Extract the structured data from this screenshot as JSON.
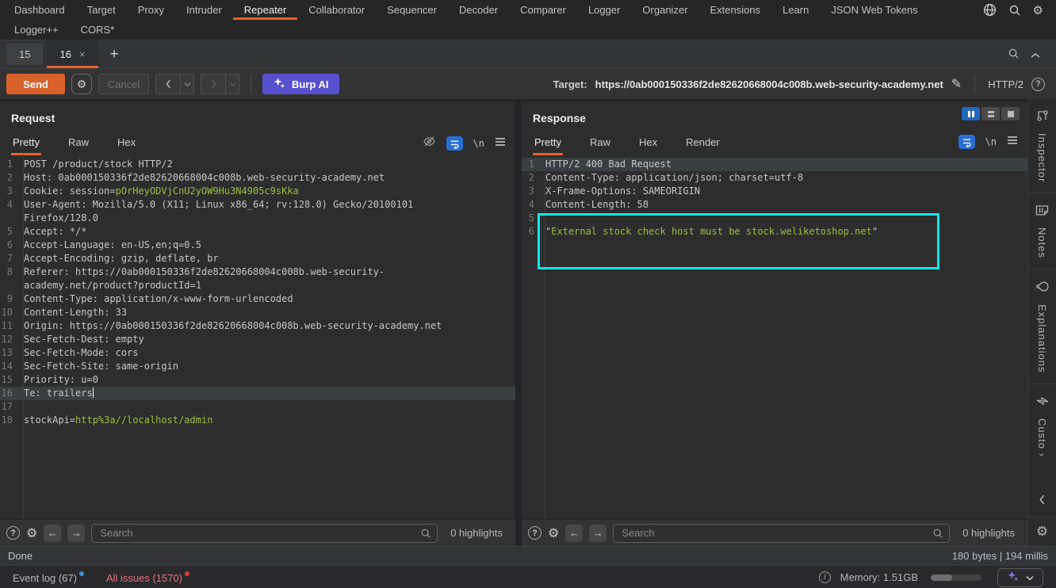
{
  "colors": {
    "accent_orange": "#e8622c",
    "accent_blue": "#2a6fd4",
    "accent_purple": "#5650cf",
    "highlight_cyan": "#10e7e7",
    "code_value_green": "#9dbf3f",
    "issues_red": "#e8717d"
  },
  "menubar": {
    "items": [
      "Dashboard",
      "Target",
      "Proxy",
      "Intruder",
      "Repeater",
      "Collaborator",
      "Sequencer",
      "Decoder",
      "Comparer",
      "Logger",
      "Organizer",
      "Extensions",
      "Learn",
      "JSON Web Tokens"
    ],
    "active_item": "Repeater",
    "row2_items": [
      "Logger++",
      "CORS*"
    ]
  },
  "session_tabs": {
    "tabs": [
      {
        "label": "15",
        "active": false
      },
      {
        "label": "16",
        "active": true,
        "close": "×"
      }
    ],
    "add_label": "+"
  },
  "toolbar": {
    "send_label": "Send",
    "cancel_label": "Cancel",
    "burp_ai_label": "Burp AI"
  },
  "target": {
    "label": "Target:",
    "url": "https://0ab000150336f2de82620668004c008b.web-security-academy.net",
    "protocol": "HTTP/2",
    "help": "?"
  },
  "request": {
    "title": "Request",
    "tabs": [
      "Pretty",
      "Raw",
      "Hex"
    ],
    "active_tab": "Pretty",
    "lines": [
      {
        "n": 1,
        "segs": [
          {
            "t": "POST /product/stock HTTP/2"
          }
        ]
      },
      {
        "n": 2,
        "segs": [
          {
            "t": "Host: 0ab000150336f2de82620668004c008b.web-security-academy.net"
          }
        ]
      },
      {
        "n": 3,
        "segs": [
          {
            "t": "Cookie: session="
          },
          {
            "t": "pOrHeyODVjCnU2yOW9Hu3N4905c9sKka",
            "c": "v"
          }
        ]
      },
      {
        "n": 4,
        "segs": [
          {
            "t": "User-Agent: Mozilla/5.0 (X11; Linux x86_64; rv:128.0) Gecko/20100101 Firefox/128.0"
          }
        ]
      },
      {
        "n": 5,
        "segs": [
          {
            "t": "Accept: */*"
          }
        ]
      },
      {
        "n": 6,
        "segs": [
          {
            "t": "Accept-Language: en-US,en;q=0.5"
          }
        ]
      },
      {
        "n": 7,
        "segs": [
          {
            "t": "Accept-Encoding: gzip, deflate, br"
          }
        ]
      },
      {
        "n": 8,
        "segs": [
          {
            "t": "Referer: https://0ab000150336f2de82620668004c008b.web-security-academy.net/product?productId=1"
          }
        ]
      },
      {
        "n": 9,
        "segs": [
          {
            "t": "Content-Type: application/x-www-form-urlencoded"
          }
        ]
      },
      {
        "n": 10,
        "segs": [
          {
            "t": "Content-Length: 33"
          }
        ]
      },
      {
        "n": 11,
        "segs": [
          {
            "t": "Origin: https://0ab000150336f2de82620668004c008b.web-security-academy.net"
          }
        ]
      },
      {
        "n": 12,
        "segs": [
          {
            "t": "Sec-Fetch-Dest: empty"
          }
        ]
      },
      {
        "n": 13,
        "segs": [
          {
            "t": "Sec-Fetch-Mode: cors"
          }
        ]
      },
      {
        "n": 14,
        "segs": [
          {
            "t": "Sec-Fetch-Site: same-origin"
          }
        ]
      },
      {
        "n": 15,
        "segs": [
          {
            "t": "Priority: u=0"
          }
        ]
      },
      {
        "n": 16,
        "segs": [
          {
            "t": "Te: trailers"
          }
        ],
        "current": true,
        "caret": true
      },
      {
        "n": 17,
        "segs": []
      },
      {
        "n": 18,
        "segs": [
          {
            "t": "stockApi="
          },
          {
            "t": "http%3a//localhost/admin",
            "c": "v"
          }
        ]
      }
    ]
  },
  "response": {
    "title": "Response",
    "tabs": [
      "Pretty",
      "Raw",
      "Hex",
      "Render"
    ],
    "active_tab": "Pretty",
    "lines": [
      {
        "n": 1,
        "segs": [
          {
            "t": "HTTP/2 400 Bad Request"
          }
        ],
        "current": true
      },
      {
        "n": 2,
        "segs": [
          {
            "t": "Content-Type: application/json; charset=utf-8"
          }
        ]
      },
      {
        "n": 3,
        "segs": [
          {
            "t": "X-Frame-Options: SAMEORIGIN"
          }
        ]
      },
      {
        "n": 4,
        "segs": [
          {
            "t": "Content-Length: 58"
          }
        ]
      },
      {
        "n": 5,
        "segs": []
      },
      {
        "n": 6,
        "segs": [
          {
            "t": "\""
          },
          {
            "t": "External stock check host must be stock.weliketoshop.net",
            "c": "v"
          },
          {
            "t": "\""
          }
        ]
      }
    ]
  },
  "find": {
    "placeholder": "Search",
    "request_highlights": "0 highlights",
    "response_highlights": "0 highlights"
  },
  "status": {
    "done": "Done",
    "size_time": "180 bytes | 194 millis"
  },
  "footer": {
    "event_log": "Event log (67)",
    "all_issues": "All issues (1570)",
    "memory": "Memory: 1.51GB"
  },
  "sidebar": {
    "items": [
      {
        "label": "Inspector"
      },
      {
        "label": "Notes"
      },
      {
        "label": "Explanations"
      },
      {
        "label": "Custo ›"
      }
    ]
  }
}
